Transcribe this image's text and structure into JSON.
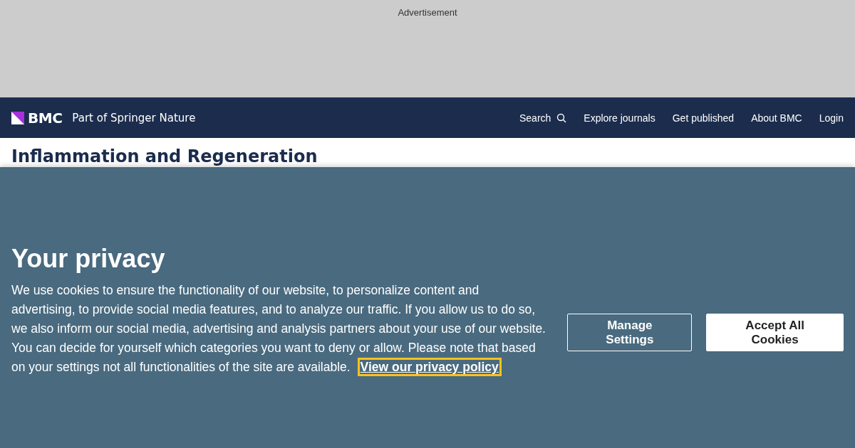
{
  "advertisement": {
    "label": "Advertisement"
  },
  "header": {
    "logo_text": "BMC",
    "tagline": "Part of Springer Nature",
    "nav": [
      {
        "label": "Search",
        "kind": "search"
      },
      {
        "label": "Explore journals",
        "kind": "link"
      },
      {
        "label": "Get published",
        "kind": "link"
      },
      {
        "label": "About BMC",
        "kind": "link"
      },
      {
        "label": "Login",
        "kind": "link"
      }
    ]
  },
  "journal_title": "Inflammation and Regeneration",
  "cookie_banner": {
    "title": "Your privacy",
    "text": "We use cookies to ensure the functionality of our website, to personalize content and advertising, to provide social media features, and to analyze our traffic. If you allow us to do so, we also inform our social media, advertising and analysis partners about your use of our website. You can decide for yourself which categories you want to deny or allow. Please note that based on your settings not all functionalities of the site are available.",
    "link": "View our privacy policy",
    "buttons": [
      {
        "label": "Manage Settings",
        "kind": "outline"
      },
      {
        "label": "Accept All Cookies",
        "kind": "filled"
      }
    ]
  }
}
